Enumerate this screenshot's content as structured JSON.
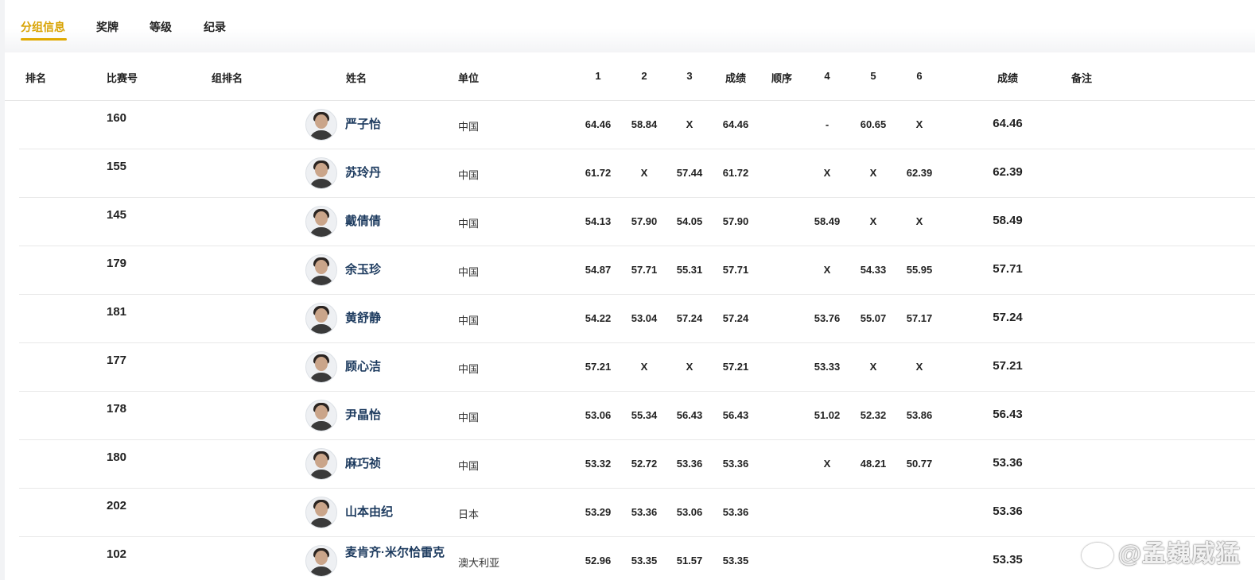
{
  "tabs": [
    {
      "label": "分组信息",
      "active": true
    },
    {
      "label": "奖牌",
      "active": false
    },
    {
      "label": "等级",
      "active": false
    },
    {
      "label": "纪录",
      "active": false
    }
  ],
  "columns": {
    "rank": "排名",
    "bib": "比赛号",
    "group_rank": "组排名",
    "name": "姓名",
    "unit": "单位",
    "t1": "1",
    "t2": "2",
    "t3": "3",
    "mid_result": "成绩",
    "order": "顺序",
    "t4": "4",
    "t5": "5",
    "t6": "6",
    "result": "成绩",
    "remark": "备注"
  },
  "rows": [
    {
      "bib": "160",
      "name": "严子怡",
      "unit": "中国",
      "t1": "64.46",
      "t2": "58.84",
      "t3": "X",
      "mid": "64.46",
      "t4": "-",
      "t5": "60.65",
      "t6": "X",
      "result": "64.46"
    },
    {
      "bib": "155",
      "name": "苏玲丹",
      "unit": "中国",
      "t1": "61.72",
      "t2": "X",
      "t3": "57.44",
      "mid": "61.72",
      "t4": "X",
      "t5": "X",
      "t6": "62.39",
      "result": "62.39"
    },
    {
      "bib": "145",
      "name": "戴倩倩",
      "unit": "中国",
      "t1": "54.13",
      "t2": "57.90",
      "t3": "54.05",
      "mid": "57.90",
      "t4": "58.49",
      "t5": "X",
      "t6": "X",
      "result": "58.49"
    },
    {
      "bib": "179",
      "name": "余玉珍",
      "unit": "中国",
      "t1": "54.87",
      "t2": "57.71",
      "t3": "55.31",
      "mid": "57.71",
      "t4": "X",
      "t5": "54.33",
      "t6": "55.95",
      "result": "57.71"
    },
    {
      "bib": "181",
      "name": "黄舒静",
      "unit": "中国",
      "t1": "54.22",
      "t2": "53.04",
      "t3": "57.24",
      "mid": "57.24",
      "t4": "53.76",
      "t5": "55.07",
      "t6": "57.17",
      "result": "57.24"
    },
    {
      "bib": "177",
      "name": "顾心洁",
      "unit": "中国",
      "t1": "57.21",
      "t2": "X",
      "t3": "X",
      "mid": "57.21",
      "t4": "53.33",
      "t5": "X",
      "t6": "X",
      "result": "57.21"
    },
    {
      "bib": "178",
      "name": "尹晶怡",
      "unit": "中国",
      "t1": "53.06",
      "t2": "55.34",
      "t3": "56.43",
      "mid": "56.43",
      "t4": "51.02",
      "t5": "52.32",
      "t6": "53.86",
      "result": "56.43"
    },
    {
      "bib": "180",
      "name": "麻巧祯",
      "unit": "中国",
      "t1": "53.32",
      "t2": "52.72",
      "t3": "53.36",
      "mid": "53.36",
      "t4": "X",
      "t5": "48.21",
      "t6": "50.77",
      "result": "53.36"
    },
    {
      "bib": "202",
      "name": "山本由纪",
      "unit": "日本",
      "t1": "53.29",
      "t2": "53.36",
      "t3": "53.06",
      "mid": "53.36",
      "t4": "",
      "t5": "",
      "t6": "",
      "result": "53.36"
    },
    {
      "bib": "102",
      "name": "麦肯齐·米尔恰雷克",
      "unit": "澳大利亚",
      "t1": "52.96",
      "t2": "53.35",
      "t3": "51.57",
      "mid": "53.35",
      "t4": "",
      "t5": "",
      "t6": "",
      "result": "53.35"
    }
  ],
  "watermark": "@孟巍威猛"
}
